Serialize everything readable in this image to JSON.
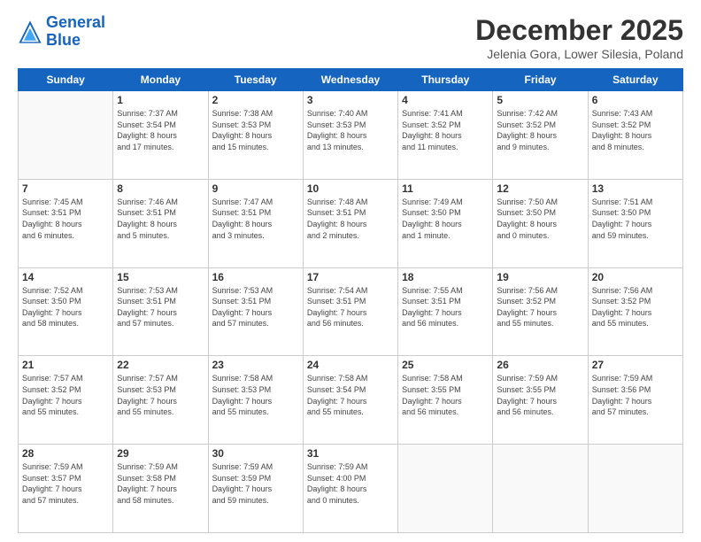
{
  "logo": {
    "line1": "General",
    "line2": "Blue"
  },
  "title": "December 2025",
  "location": "Jelenia Gora, Lower Silesia, Poland",
  "weekdays": [
    "Sunday",
    "Monday",
    "Tuesday",
    "Wednesday",
    "Thursday",
    "Friday",
    "Saturday"
  ],
  "weeks": [
    [
      {
        "day": "",
        "info": ""
      },
      {
        "day": "1",
        "info": "Sunrise: 7:37 AM\nSunset: 3:54 PM\nDaylight: 8 hours\nand 17 minutes."
      },
      {
        "day": "2",
        "info": "Sunrise: 7:38 AM\nSunset: 3:53 PM\nDaylight: 8 hours\nand 15 minutes."
      },
      {
        "day": "3",
        "info": "Sunrise: 7:40 AM\nSunset: 3:53 PM\nDaylight: 8 hours\nand 13 minutes."
      },
      {
        "day": "4",
        "info": "Sunrise: 7:41 AM\nSunset: 3:52 PM\nDaylight: 8 hours\nand 11 minutes."
      },
      {
        "day": "5",
        "info": "Sunrise: 7:42 AM\nSunset: 3:52 PM\nDaylight: 8 hours\nand 9 minutes."
      },
      {
        "day": "6",
        "info": "Sunrise: 7:43 AM\nSunset: 3:52 PM\nDaylight: 8 hours\nand 8 minutes."
      }
    ],
    [
      {
        "day": "7",
        "info": "Sunrise: 7:45 AM\nSunset: 3:51 PM\nDaylight: 8 hours\nand 6 minutes."
      },
      {
        "day": "8",
        "info": "Sunrise: 7:46 AM\nSunset: 3:51 PM\nDaylight: 8 hours\nand 5 minutes."
      },
      {
        "day": "9",
        "info": "Sunrise: 7:47 AM\nSunset: 3:51 PM\nDaylight: 8 hours\nand 3 minutes."
      },
      {
        "day": "10",
        "info": "Sunrise: 7:48 AM\nSunset: 3:51 PM\nDaylight: 8 hours\nand 2 minutes."
      },
      {
        "day": "11",
        "info": "Sunrise: 7:49 AM\nSunset: 3:50 PM\nDaylight: 8 hours\nand 1 minute."
      },
      {
        "day": "12",
        "info": "Sunrise: 7:50 AM\nSunset: 3:50 PM\nDaylight: 8 hours\nand 0 minutes."
      },
      {
        "day": "13",
        "info": "Sunrise: 7:51 AM\nSunset: 3:50 PM\nDaylight: 7 hours\nand 59 minutes."
      }
    ],
    [
      {
        "day": "14",
        "info": "Sunrise: 7:52 AM\nSunset: 3:50 PM\nDaylight: 7 hours\nand 58 minutes."
      },
      {
        "day": "15",
        "info": "Sunrise: 7:53 AM\nSunset: 3:51 PM\nDaylight: 7 hours\nand 57 minutes."
      },
      {
        "day": "16",
        "info": "Sunrise: 7:53 AM\nSunset: 3:51 PM\nDaylight: 7 hours\nand 57 minutes."
      },
      {
        "day": "17",
        "info": "Sunrise: 7:54 AM\nSunset: 3:51 PM\nDaylight: 7 hours\nand 56 minutes."
      },
      {
        "day": "18",
        "info": "Sunrise: 7:55 AM\nSunset: 3:51 PM\nDaylight: 7 hours\nand 56 minutes."
      },
      {
        "day": "19",
        "info": "Sunrise: 7:56 AM\nSunset: 3:52 PM\nDaylight: 7 hours\nand 55 minutes."
      },
      {
        "day": "20",
        "info": "Sunrise: 7:56 AM\nSunset: 3:52 PM\nDaylight: 7 hours\nand 55 minutes."
      }
    ],
    [
      {
        "day": "21",
        "info": "Sunrise: 7:57 AM\nSunset: 3:52 PM\nDaylight: 7 hours\nand 55 minutes."
      },
      {
        "day": "22",
        "info": "Sunrise: 7:57 AM\nSunset: 3:53 PM\nDaylight: 7 hours\nand 55 minutes."
      },
      {
        "day": "23",
        "info": "Sunrise: 7:58 AM\nSunset: 3:53 PM\nDaylight: 7 hours\nand 55 minutes."
      },
      {
        "day": "24",
        "info": "Sunrise: 7:58 AM\nSunset: 3:54 PM\nDaylight: 7 hours\nand 55 minutes."
      },
      {
        "day": "25",
        "info": "Sunrise: 7:58 AM\nSunset: 3:55 PM\nDaylight: 7 hours\nand 56 minutes."
      },
      {
        "day": "26",
        "info": "Sunrise: 7:59 AM\nSunset: 3:55 PM\nDaylight: 7 hours\nand 56 minutes."
      },
      {
        "day": "27",
        "info": "Sunrise: 7:59 AM\nSunset: 3:56 PM\nDaylight: 7 hours\nand 57 minutes."
      }
    ],
    [
      {
        "day": "28",
        "info": "Sunrise: 7:59 AM\nSunset: 3:57 PM\nDaylight: 7 hours\nand 57 minutes."
      },
      {
        "day": "29",
        "info": "Sunrise: 7:59 AM\nSunset: 3:58 PM\nDaylight: 7 hours\nand 58 minutes."
      },
      {
        "day": "30",
        "info": "Sunrise: 7:59 AM\nSunset: 3:59 PM\nDaylight: 7 hours\nand 59 minutes."
      },
      {
        "day": "31",
        "info": "Sunrise: 7:59 AM\nSunset: 4:00 PM\nDaylight: 8 hours\nand 0 minutes."
      },
      {
        "day": "",
        "info": ""
      },
      {
        "day": "",
        "info": ""
      },
      {
        "day": "",
        "info": ""
      }
    ]
  ]
}
